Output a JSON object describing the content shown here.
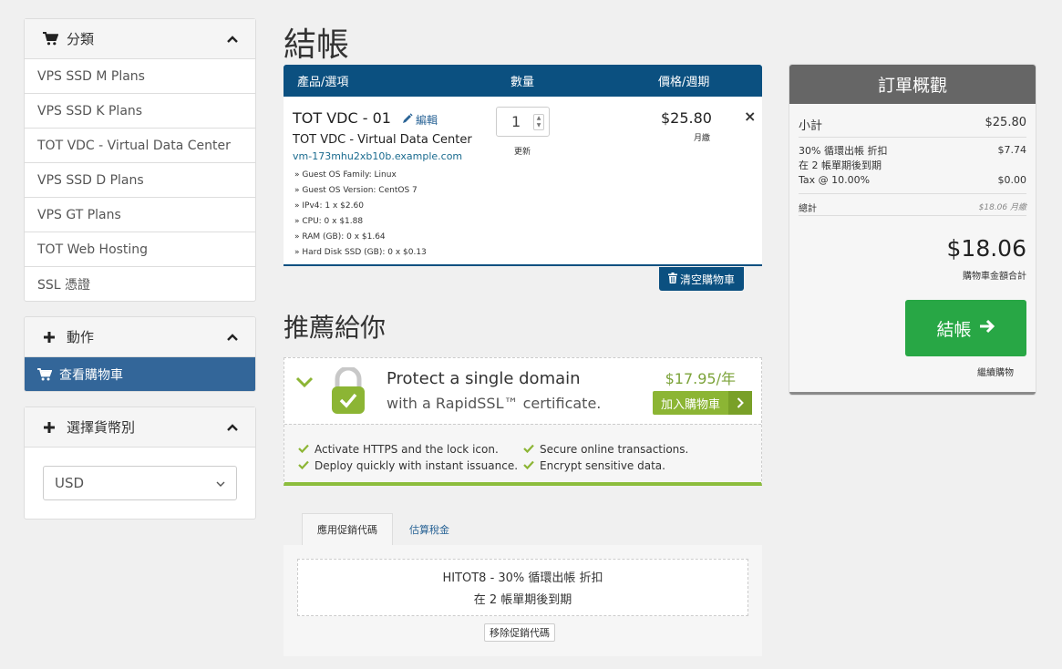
{
  "sidebar": {
    "categories": {
      "title": "分類",
      "items": [
        "VPS SSD M Plans",
        "VPS SSD K Plans",
        "TOT VDC - Virtual Data Center",
        "VPS SSD D Plans",
        "VPS GT Plans",
        "TOT Web Hosting",
        "SSL 憑證"
      ]
    },
    "actions": {
      "title": "動作",
      "view_cart": "查看購物車"
    },
    "currency": {
      "title": "選擇貨幣別",
      "selected": "USD"
    }
  },
  "page": {
    "title": "結帳"
  },
  "cart": {
    "headers": {
      "product": "產品/選項",
      "qty": "數量",
      "price": "價格/週期"
    },
    "item": {
      "title": "TOT VDC - 01",
      "edit": "編輯",
      "subtitle": "TOT VDC - Virtual Data Center",
      "hostname": "vm-173mhu2xb10b.example.com",
      "options": [
        "» Guest OS Family: Linux",
        "» Guest OS Version: CentOS 7",
        "» IPv4: 1 x $2.60",
        "» CPU: 0 x $1.88",
        "» RAM (GB): 0 x $1.64",
        "» Hard Disk SSD (GB): 0 x $0.13"
      ],
      "qty": "1",
      "update": "更新",
      "price": "$25.80",
      "cycle": "月繳",
      "remove": "×"
    },
    "empty_cart": "清空購物車"
  },
  "recommend": {
    "title": "推薦給你",
    "product_title": "Protect a single domain",
    "product_sub": "with a RapidSSL™ certificate.",
    "price": "$17.95/年",
    "add_label": "加入購物車",
    "features": [
      "Activate HTTPS and the lock icon.",
      "Secure online transactions.",
      "Deploy quickly with instant issuance.",
      "Encrypt sensitive data."
    ]
  },
  "promo": {
    "tabs": [
      "應用促銷代碼",
      "估算稅金"
    ],
    "line1": "HITOT8 - 30% 循環出帳 折扣",
    "line2": "在 2 帳單期後到期",
    "remove": "移除促銷代碼"
  },
  "summary": {
    "title": "訂單概觀",
    "subtotal_label": "小計",
    "subtotal": "$25.80",
    "discount_label": "30% 循環出帳 折扣",
    "discount_label2": "在 2 帳單期後到期",
    "discount": "$7.74",
    "tax_label": "Tax @ 10.00%",
    "tax": "$0.00",
    "recurring_label": "總計",
    "recurring": "$18.06 月繳",
    "total": "$18.06",
    "total_label": "購物車金額合計",
    "checkout": "結帳",
    "continue": "繼續購物"
  },
  "colors": {
    "primary": "#0b5080",
    "sidebar_active": "#336699",
    "success": "#28a745",
    "ssl_green": "#8cb534"
  }
}
